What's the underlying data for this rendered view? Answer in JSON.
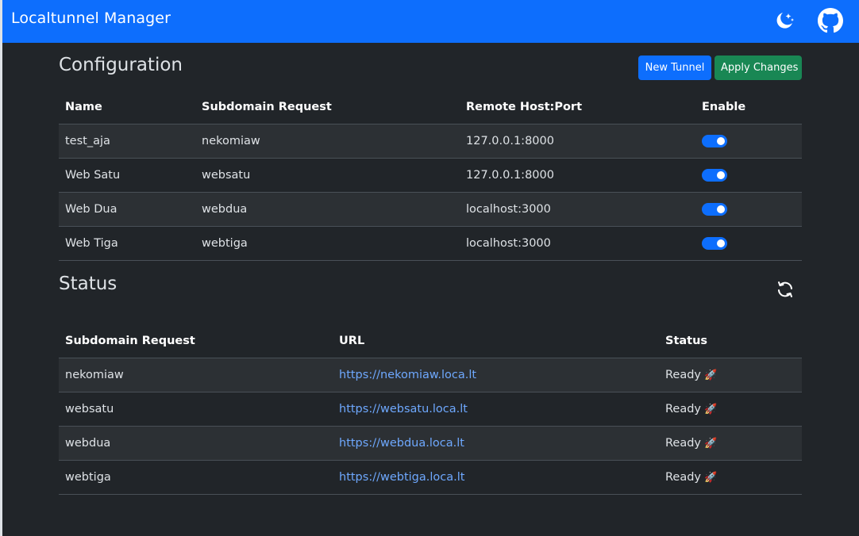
{
  "navbar": {
    "title": "Localtunnel Manager",
    "theme_icon": "moon-stars-icon",
    "github_icon": "github-icon",
    "color": "#0d6efd"
  },
  "configuration": {
    "title": "Configuration",
    "new_button": "New Tunnel",
    "apply_button": "Apply Changes",
    "columns": [
      "Name",
      "Subdomain Request",
      "Remote Host:Port",
      "Enable"
    ],
    "rows": [
      {
        "name": "test_aja",
        "subdomain": "nekomiaw",
        "remote": "127.0.0.1:8000",
        "enabled": true
      },
      {
        "name": "Web Satu",
        "subdomain": "websatu",
        "remote": "127.0.0.1:8000",
        "enabled": true
      },
      {
        "name": "Web Dua",
        "subdomain": "webdua",
        "remote": "localhost:3000",
        "enabled": true
      },
      {
        "name": "Web Tiga",
        "subdomain": "webtiga",
        "remote": "localhost:3000",
        "enabled": true
      }
    ]
  },
  "status": {
    "title": "Status",
    "refresh_icon": "refresh-icon",
    "columns": [
      "Subdomain Request",
      "URL",
      "Status"
    ],
    "rows": [
      {
        "subdomain": "nekomiaw",
        "url": "https://nekomiaw.loca.lt",
        "status": "Ready",
        "status_icon": "🚀"
      },
      {
        "subdomain": "websatu",
        "url": "https://websatu.loca.lt",
        "status": "Ready",
        "status_icon": "🚀"
      },
      {
        "subdomain": "webdua",
        "url": "https://webdua.loca.lt",
        "status": "Ready",
        "status_icon": "🚀"
      },
      {
        "subdomain": "webtiga",
        "url": "https://webtiga.loca.lt",
        "status": "Ready",
        "status_icon": "🚀"
      }
    ]
  }
}
